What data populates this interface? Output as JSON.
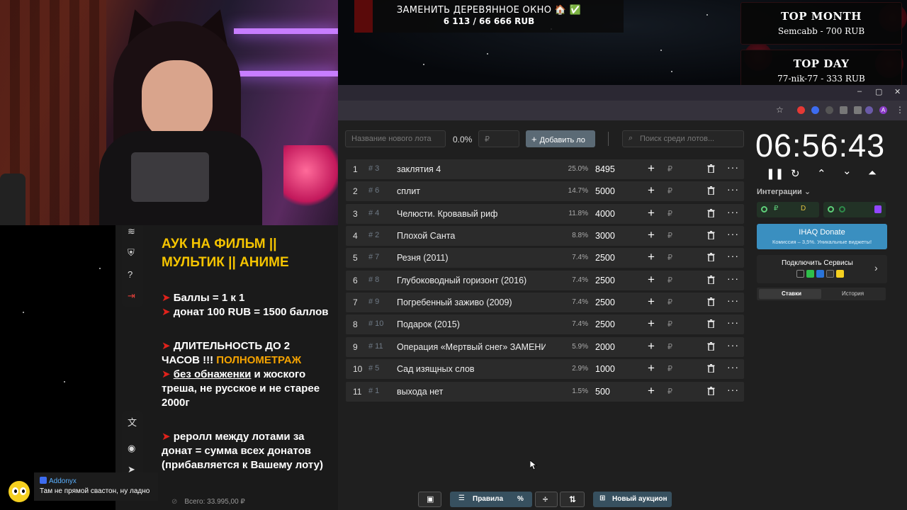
{
  "goal": {
    "title": "ЗАМЕНИТЬ ДЕРЕВЯННОЕ ОКНО 🏠 ✅",
    "amount": "6 113 / 66 666 RUB"
  },
  "top_month": {
    "title": "TOP MONTH",
    "line": "Semcabb - 700 RUB"
  },
  "top_day": {
    "title": "TOP DAY",
    "line": "77-nik-77 - 333 RUB"
  },
  "browser": {
    "minimize": "–",
    "maximize": "▢",
    "close": "✕",
    "bookmark": "☆",
    "menu": "⋮",
    "profile": "A"
  },
  "auction": {
    "new_lot_placeholder": "Название нового лота",
    "percent": "0.0%",
    "amount_placeholder": "₽",
    "add_button": "Добавить ло",
    "search_placeholder": "Поиск среди лотов...",
    "lots": [
      {
        "num": "1",
        "id": "# 3",
        "name": "заклятия 4",
        "percent": "25.0%",
        "amount": "8495"
      },
      {
        "num": "2",
        "id": "# 6",
        "name": "сплит",
        "percent": "14.7%",
        "amount": "5000"
      },
      {
        "num": "3",
        "id": "# 4",
        "name": "Челюсти. Кровавый риф",
        "percent": "11.8%",
        "amount": "4000"
      },
      {
        "num": "4",
        "id": "# 2",
        "name": "Плохой Санта",
        "percent": "8.8%",
        "amount": "3000"
      },
      {
        "num": "5",
        "id": "# 7",
        "name": "Резня (2011)",
        "percent": "7.4%",
        "amount": "2500"
      },
      {
        "num": "6",
        "id": "# 8",
        "name": "Глубоководный горизонт (2016)",
        "percent": "7.4%",
        "amount": "2500"
      },
      {
        "num": "7",
        "id": "# 9",
        "name": "Погребенный заживо (2009)",
        "percent": "7.4%",
        "amount": "2500"
      },
      {
        "num": "8",
        "id": "# 10",
        "name": "Подарок (2015)",
        "percent": "7.4%",
        "amount": "2500"
      },
      {
        "num": "9",
        "id": "# 11",
        "name": "Операция «Мертвый снег» ЗАМЕНИ",
        "percent": "5.9%",
        "amount": "2000"
      },
      {
        "num": "10",
        "id": "# 5",
        "name": "Сад изящных слов",
        "percent": "2.9%",
        "amount": "1000"
      },
      {
        "num": "11",
        "id": "# 1",
        "name": "выхода нет",
        "percent": "1.5%",
        "amount": "500"
      }
    ],
    "plus": "+",
    "rub": "₽",
    "more": "···"
  },
  "timer": {
    "time": "06:56:43"
  },
  "integrations": {
    "label": "Интеграции ⌄",
    "ihaq_title": "IHAQ Donate",
    "ihaq_sub": "Комиссия – 3,5%. Уникальные виджеты!",
    "connect": "Подключить Сервисы",
    "tab_bets": "Ставки",
    "tab_history": "История"
  },
  "info": {
    "headline_1": "АУК НА ФИЛЬМ ||",
    "headline_2": "МУЛЬТИК || АНИМЕ",
    "l1": "Баллы = 1 к 1",
    "l2": "донат 100 RUB = 1500 баллов",
    "l3a": "ДЛИТЕЛЬНОСТЬ ДО 2",
    "l3b": "ЧАСОВ !!! ",
    "l3c": "ПОЛНОМЕТРАЖ",
    "l4a": "без обнаженки",
    "l4b": " и жоского",
    "l4c": "треша, не русское и не старее",
    "l4d": "2000г",
    "l5a": "реролл между лотами за",
    "l5b": "донат = сумма всех донатов",
    "l5c": "(прибавляется к Вашему лоту)",
    "arrow": "➤"
  },
  "chat": {
    "user": "Addonyx",
    "message": "Там не прямой свастон, ну ладно"
  },
  "footer": {
    "total": "Всего: 33.995,00 ₽",
    "rules": "Правила",
    "percent": "%",
    "new_auction": "Новый аукцион"
  },
  "colors": {
    "accent": "#37505f",
    "headline": "#f5c400",
    "arrow": "#e0221b",
    "ihaq": "#3a8fc0"
  }
}
